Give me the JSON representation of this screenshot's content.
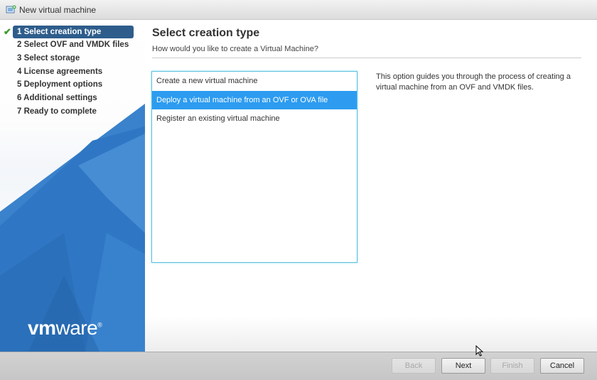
{
  "window": {
    "title": "New virtual machine",
    "icon": "new-vm-icon"
  },
  "sidebar": {
    "steps": [
      {
        "label": "1 Select creation type",
        "active": true,
        "completed": true
      },
      {
        "label": "2 Select OVF and VMDK files"
      },
      {
        "label": "3 Select storage"
      },
      {
        "label": "4 License agreements"
      },
      {
        "label": "5 Deployment options"
      },
      {
        "label": "6 Additional settings"
      },
      {
        "label": "7 Ready to complete"
      }
    ],
    "logo": {
      "text_vm": "vm",
      "text_ware": "ware",
      "reg": "®"
    }
  },
  "main": {
    "title": "Select creation type",
    "subtitle": "How would you like to create a Virtual Machine?",
    "options": [
      {
        "label": "Create a new virtual machine"
      },
      {
        "label": "Deploy a virtual machine from an OVF or OVA file",
        "selected": true
      },
      {
        "label": "Register an existing virtual machine"
      }
    ],
    "description": "This option guides you through the process of creating a virtual machine from an OVF and VMDK files."
  },
  "footer": {
    "back": "Back",
    "next": "Next",
    "finish": "Finish",
    "cancel": "Cancel"
  },
  "colors": {
    "active_step_bg": "#2e5d8c",
    "selected_option_bg": "#2d9cf0",
    "list_border": "#5bc0de",
    "sidebar_blue": "#2f77c4",
    "check_green": "#3c9a2b"
  }
}
